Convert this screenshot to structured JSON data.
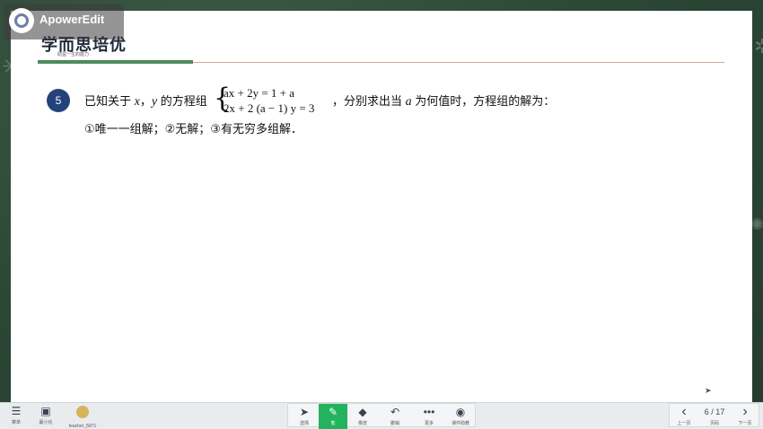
{
  "watermark": {
    "text": "ApowerEdit"
  },
  "logo": {
    "title": "学而思培优",
    "subtitle": "助益一生的能力"
  },
  "question": {
    "number": "5",
    "line1_start": "已知关于",
    "var_x": "x",
    "comma": "，",
    "var_y": "y",
    "line1_mid": "的方程组",
    "eq1": "ax + 2y = 1 + a",
    "eq2": "2x + 2 (a − 1) y = 3",
    "line1_end_a": "，分别求出当",
    "var_a": "a",
    "line1_end_b": "为何值时，方程组的解为：",
    "line2": "①唯一一组解；②无解；③有无穷多组解．"
  },
  "toolbar": {
    "left": [
      {
        "icon": "menu-icon",
        "glyph": "☰",
        "label": "菜单"
      },
      {
        "icon": "mini-window-icon",
        "glyph": "▣",
        "label": "最小化"
      },
      {
        "icon": "avatar-icon",
        "glyph": "",
        "label": "teacher_5871"
      }
    ],
    "center": [
      {
        "icon": "select-arrow-icon",
        "glyph": "➤",
        "label": "选择"
      },
      {
        "icon": "pen-icon",
        "glyph": "✎",
        "label": "笔"
      },
      {
        "icon": "eraser-icon",
        "glyph": "◆",
        "label": "橡皮"
      },
      {
        "icon": "undo-icon",
        "glyph": "↶",
        "label": "撤销"
      },
      {
        "icon": "more-icon",
        "glyph": "•••",
        "label": "更多"
      },
      {
        "icon": "camera-icon",
        "glyph": "◉",
        "label": "课件助教"
      }
    ],
    "right": {
      "prev_glyph": "‹",
      "prev_label": "上一页",
      "page_text": "6 / 17",
      "page_label": "页码",
      "next_glyph": "›",
      "next_label": "下一页"
    }
  },
  "colors": {
    "accent_green": "#22b35e",
    "question_badge": "#23427a",
    "header_green": "#4e8a5d"
  }
}
